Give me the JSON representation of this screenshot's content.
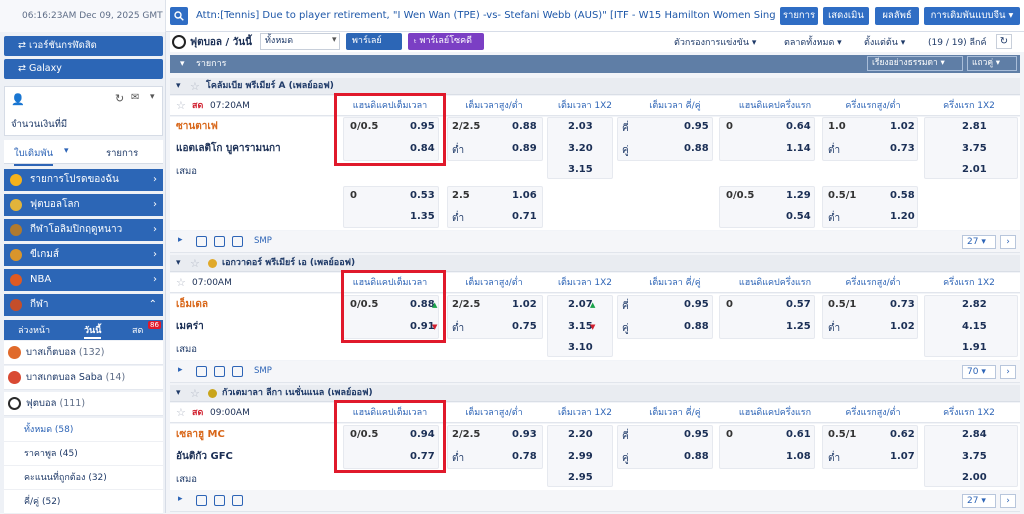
{
  "header": {
    "clock": "06:16:23AM Dec 09, 2025 GMT +7",
    "ticker": "Attn:[Tennis] Due to player retirement, \"I Wen Wan (TPE) -vs- Stefani Webb (AUS)\" [ITF - W15 Hamilton Women Singles - 8/12],",
    "btn_rules": "รายการ",
    "btn_settle": "เสดงเมิน",
    "btn_results": "ผลลัพธ์",
    "btn_bettype": "การเดิมพันแบบจีน ▾"
  },
  "sidebar": {
    "switch1": "⇄ เวอร์ชันกรฬัดสิด",
    "switch2": "⇄ Galaxy",
    "balance_label": "จำนวนเงินที่มี",
    "tab_bets": "ใบเดิมพัน",
    "tab_list": "รายการ",
    "cats": [
      {
        "label": "รายการโปรดของฉัน",
        "color": "#f5b21b"
      },
      {
        "label": "ฟุตบอลโลก",
        "color": "#e2b43a"
      },
      {
        "label": "กีฬาโอลิมปิกฤดูหนาว",
        "color": "#b07a2e"
      },
      {
        "label": "ขีเกมส์",
        "color": "#d9952b"
      },
      {
        "label": "NBA",
        "color": "#e05a22"
      },
      {
        "label": "กีฬา",
        "color": "#c44e2a"
      }
    ],
    "period_tabs": [
      "ล่วงหน้า",
      "วันนี้",
      "สด"
    ],
    "live_badge": "86",
    "sports": [
      {
        "name": "บาสเก็ตบอล",
        "count": "(132)",
        "color": "#e06a2b"
      },
      {
        "name": "บาสเกตบอล Saba",
        "count": "(14)",
        "color": "#d94a33"
      },
      {
        "name": "ฟุตบอล",
        "count": "(111)",
        "color": "#2a2a2a"
      }
    ],
    "subs": [
      {
        "label": "ทั้งหมด",
        "count": "(58)"
      },
      {
        "label": "ราคาพูล",
        "count": "(45)"
      },
      {
        "label": "คะแนนที่ถูกต้อง",
        "count": "(32)"
      },
      {
        "label": "คี่/คู่",
        "count": "(52)"
      }
    ]
  },
  "toolbar": {
    "title": "ฟุตบอล / วันนี้",
    "filter": "ทั้งหมด",
    "parlay": "พาร์เลย์",
    "parlay_sports": "ₜ พาร์เลย์โซคดี",
    "filter_league": "ตัวกรองการแข่งขัน ▾",
    "market": "ตลาดทั้งหมด ▾",
    "sort_time": "ตั้งแต่ต้น ▾",
    "count": "(19 / 19) ลีกค์",
    "list_label": "รายการ",
    "sort_label": "เรียงอย่างธรรมดา ▾",
    "view_label": "แถวคู่ ▾"
  },
  "columns": [
    "แฮนดิแคปเต็มเวลา",
    "เต็มเวลาสูง/ต่ำ",
    "เต็มเวลา 1X2",
    "เต็มเวลา คี่/คู่",
    "แฮนดิแคปครึ่งแรก",
    "ครึ่งแรกสูง/ต่ำ",
    "ครึ่งแรก 1X2"
  ],
  "leagues": [
    {
      "name": "โคลัมเบีย พรีเมียร์ A (เพลย์ออฟ)",
      "live": "สด",
      "time": "07:20AM",
      "home": "ซานตาเฟ",
      "away": "แอตเลติโก บูคารามนกา",
      "draw": "เสมอ",
      "hdp": "0/0.5",
      "hdp_h": "0.95",
      "hdp_a": "0.84",
      "ou": "2/2.5",
      "ou_o": "0.88",
      "ou_u_lbl": "ต่ำ",
      "ou_u": "0.89",
      "x1": "2.03",
      "x2": "3.20",
      "xd": "3.15",
      "oe_o_lbl": "คี่",
      "oe_o": "0.95",
      "oe_e_lbl": "คู่",
      "oe_e": "0.88",
      "fh": "0",
      "fh_h": "0.64",
      "fh_a": "1.14",
      "fou": "1.0",
      "fou_o": "1.02",
      "fou_u_lbl": "ต่ำ",
      "fou_u": "0.73",
      "f1": "2.81",
      "f2": "3.75",
      "fd": "2.01",
      "alt": {
        "hdp": "0",
        "hdp_h": "0.53",
        "hdp_a": "1.35",
        "ou": "2.5",
        "ou_o": "1.06",
        "ou_u_lbl": "ต่ำ",
        "ou_u": "0.71",
        "fh": "0/0.5",
        "fh_h": "1.29",
        "fh_a": "0.54",
        "fou": "0.5/1",
        "fou_o": "0.58",
        "fou_u_lbl": "ต่ำ",
        "fou_u": "1.20"
      },
      "pager": "27 ▾",
      "smp": "SMP"
    },
    {
      "name": "เอกวาดอร์ พรีเมียร์ เอ (เพลย์ออฟ)",
      "live": "",
      "time": "07:00AM",
      "home": "เอ็มเดล",
      "away": "เมคร่า",
      "draw": "เสมอ",
      "hdp": "0/0.5",
      "hdp_h": "0.88",
      "hdp_a": "0.91",
      "ou": "2/2.5",
      "ou_o": "1.02",
      "ou_u_lbl": "ต่ำ",
      "ou_u": "0.75",
      "x1": "2.07",
      "x2": "3.15",
      "xd": "3.10",
      "oe_o_lbl": "คี่",
      "oe_o": "0.95",
      "oe_e_lbl": "คู่",
      "oe_e": "0.88",
      "fh": "0",
      "fh_h": "0.57",
      "fh_a": "1.25",
      "fou": "0.5/1",
      "fou_o": "0.73",
      "fou_u_lbl": "ต่ำ",
      "fou_u": "1.02",
      "f1": "2.82",
      "f2": "4.15",
      "fd": "1.91",
      "pager": "70 ▾",
      "smp": "SMP"
    },
    {
      "name": "กัวเตมาลา ลีกา เนชั่นแนล (เพลย์ออฟ)",
      "live": "สด",
      "time": "09:00AM",
      "home": "เซลาฮู MC",
      "away": "อันติกัว GFC",
      "draw": "เสมอ",
      "hdp": "0/0.5",
      "hdp_h": "0.94",
      "hdp_a": "0.77",
      "ou": "2/2.5",
      "ou_o": "0.93",
      "ou_u_lbl": "ต่ำ",
      "ou_u": "0.78",
      "x1": "2.20",
      "x2": "2.99",
      "xd": "2.95",
      "oe_o_lbl": "คี่",
      "oe_o": "0.95",
      "oe_e_lbl": "คู่",
      "oe_e": "0.88",
      "fh": "0",
      "fh_h": "0.61",
      "fh_a": "1.08",
      "fou": "0.5/1",
      "fou_o": "0.62",
      "fou_u_lbl": "ต่ำ",
      "fou_u": "1.07",
      "f1": "2.84",
      "f2": "3.75",
      "fd": "2.00",
      "pager": "27 ▾",
      "smp": "SMP"
    }
  ]
}
